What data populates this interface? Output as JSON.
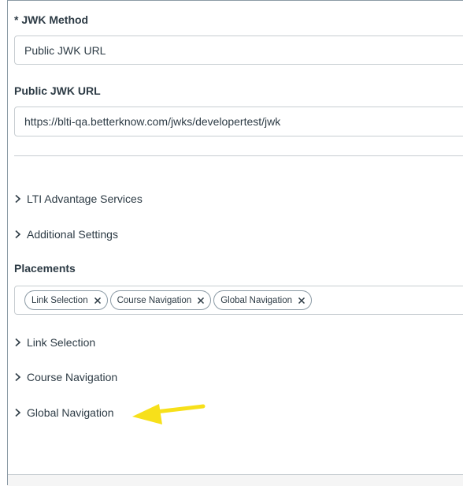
{
  "jwk_method": {
    "label": "* JWK Method",
    "value": "Public JWK URL"
  },
  "public_jwk_url": {
    "label": "Public JWK URL",
    "value": "https://blti-qa.betterknow.com/jwks/developertest/jwk"
  },
  "sections": {
    "lti_advantage": "LTI Advantage Services",
    "additional_settings": "Additional Settings"
  },
  "placements": {
    "label": "Placements",
    "tags": [
      "Link Selection",
      "Course Navigation",
      "Global Navigation"
    ]
  },
  "placement_sections": [
    "Link Selection",
    "Course Navigation",
    "Global Navigation"
  ],
  "icons": {
    "chevron": "chevron-right-icon",
    "remove": "close-icon",
    "annotation": "arrow-left-icon"
  },
  "colors": {
    "text": "#2d3b45",
    "border": "#c7cdd1",
    "arrow": "#f7e01a"
  }
}
